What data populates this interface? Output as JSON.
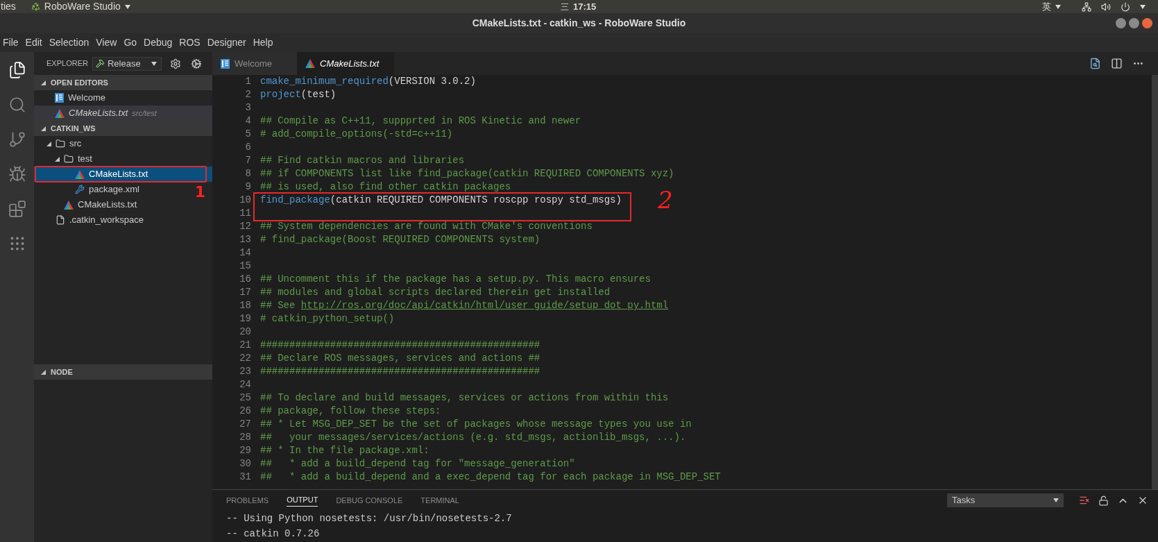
{
  "top_bar": {
    "activities": "ties",
    "app_menu": "RoboWare Studio",
    "menu_glyph": "三",
    "clock": "17:15",
    "input_method": "英"
  },
  "window": {
    "title": "CMakeLists.txt - catkin_ws - RoboWare Studio"
  },
  "menu": [
    "File",
    "Edit",
    "Selection",
    "View",
    "Go",
    "Debug",
    "ROS",
    "Designer",
    "Help"
  ],
  "activity_bar": [
    {
      "kind": "files",
      "selected": true
    },
    {
      "kind": "search",
      "selected": false
    },
    {
      "kind": "branch",
      "selected": false
    },
    {
      "kind": "debug",
      "selected": false
    },
    {
      "kind": "blocks",
      "selected": false
    },
    {
      "kind": "grid",
      "selected": false
    }
  ],
  "sidebar": {
    "title": "EXPLORER",
    "build_select": "Release",
    "open_editors": {
      "title": "OPEN EDITORS",
      "expanded": true,
      "items": [
        {
          "name": "Welcome",
          "kind": "welcome",
          "preview": false,
          "selected": false
        },
        {
          "name": "CMakeLists.txt",
          "kind": "cmake",
          "description": "src/test",
          "preview": true,
          "selected": true
        }
      ]
    },
    "workspace": {
      "title": "CATKIN_WS",
      "expanded": true,
      "items": [
        {
          "name": "src",
          "kind": "folder",
          "expanded": true,
          "selected": false,
          "boxed": false,
          "children": [
            {
              "name": "test",
              "kind": "folder",
              "expanded": true,
              "selected": false,
              "boxed": false,
              "children": [
                {
                  "name": "CMakeLists.txt",
                  "kind": "cmake",
                  "selected": true,
                  "boxed": true
                },
                {
                  "name": "package.xml",
                  "kind": "xml",
                  "selected": false,
                  "boxed": false,
                  "note": "1"
                }
              ]
            },
            {
              "name": "CMakeLists.txt",
              "kind": "cmake",
              "selected": false,
              "boxed": false
            }
          ]
        },
        {
          "name": ".catkin_workspace",
          "kind": "file",
          "selected": false,
          "boxed": false
        }
      ]
    },
    "node": {
      "title": "NODE",
      "expanded": true
    }
  },
  "tabs": [
    {
      "label": "Welcome",
      "kind": "welcome",
      "selected": false,
      "preview": false
    },
    {
      "label": "CMakeLists.txt",
      "kind": "cmake",
      "selected": true,
      "preview": true
    }
  ],
  "code": [
    {
      "number": "1",
      "boxed": false,
      "segments": [
        {
          "kind": "func",
          "text": "cmake_minimum_required"
        },
        {
          "kind": "text",
          "text": "(VERSION 3.0.2)"
        }
      ]
    },
    {
      "number": "2",
      "boxed": false,
      "segments": [
        {
          "kind": "func",
          "text": "project"
        },
        {
          "kind": "text",
          "text": "(test)"
        }
      ]
    },
    {
      "number": "3",
      "boxed": false
    },
    {
      "number": "4",
      "boxed": false,
      "segments": [
        {
          "kind": "comment",
          "text": "## Compile as C++11, suppprted in ROS Kinetic and newer"
        }
      ]
    },
    {
      "number": "5",
      "boxed": false,
      "segments": [
        {
          "kind": "comment",
          "text": "# add_compile_options(-std=c++11)"
        }
      ]
    },
    {
      "number": "6",
      "boxed": false
    },
    {
      "number": "7",
      "boxed": false,
      "segments": [
        {
          "kind": "comment",
          "text": "## Find catkin macros and libraries"
        }
      ]
    },
    {
      "number": "8",
      "boxed": false,
      "segments": [
        {
          "kind": "comment",
          "text": "## if COMPONENTS list like find_package(catkin REQUIRED COMPONENTS xyz)"
        }
      ]
    },
    {
      "number": "9",
      "boxed": false,
      "segments": [
        {
          "kind": "comment",
          "text": "## is used, also find other catkin packages"
        }
      ]
    },
    {
      "number": "10",
      "boxed": true,
      "note": "2",
      "segments": [
        {
          "kind": "func",
          "text": "find_package"
        },
        {
          "kind": "text",
          "text": "(catkin REQUIRED COMPONENTS roscpp rospy std_msgs)"
        }
      ]
    },
    {
      "number": "11",
      "boxed": true
    },
    {
      "number": "12",
      "boxed": false,
      "segments": [
        {
          "kind": "comment",
          "text": "## System dependencies are found with CMake's conventions"
        }
      ]
    },
    {
      "number": "13",
      "boxed": false,
      "segments": [
        {
          "kind": "comment",
          "text": "# find_package(Boost REQUIRED COMPONENTS system)"
        }
      ]
    },
    {
      "number": "14",
      "boxed": false
    },
    {
      "number": "15",
      "boxed": false
    },
    {
      "number": "16",
      "boxed": false,
      "segments": [
        {
          "kind": "comment",
          "text": "## Uncomment this if the package has a setup.py. This macro ensures"
        }
      ]
    },
    {
      "number": "17",
      "boxed": false,
      "segments": [
        {
          "kind": "comment",
          "text": "## modules and global scripts declared therein get installed"
        }
      ]
    },
    {
      "number": "18",
      "boxed": false,
      "segments": [
        {
          "kind": "comment",
          "text": "## See "
        },
        {
          "kind": "link",
          "text": "http://ros.org/doc/api/catkin/html/user_guide/setup_dot_py.html"
        }
      ]
    },
    {
      "number": "19",
      "boxed": false,
      "segments": [
        {
          "kind": "comment",
          "text": "# catkin_python_setup()"
        }
      ]
    },
    {
      "number": "20",
      "boxed": false
    },
    {
      "number": "21",
      "boxed": false,
      "segments": [
        {
          "kind": "comment",
          "text": "################################################"
        }
      ]
    },
    {
      "number": "22",
      "boxed": false,
      "segments": [
        {
          "kind": "comment",
          "text": "## Declare ROS messages, services and actions ##"
        }
      ]
    },
    {
      "number": "23",
      "boxed": false,
      "segments": [
        {
          "kind": "comment",
          "text": "################################################"
        }
      ]
    },
    {
      "number": "24",
      "boxed": false
    },
    {
      "number": "25",
      "boxed": false,
      "segments": [
        {
          "kind": "comment",
          "text": "## To declare and build messages, services or actions from within this"
        }
      ]
    },
    {
      "number": "26",
      "boxed": false,
      "segments": [
        {
          "kind": "comment",
          "text": "## package, follow these steps:"
        }
      ]
    },
    {
      "number": "27",
      "boxed": false,
      "segments": [
        {
          "kind": "comment",
          "text": "## * Let MSG_DEP_SET be the set of packages whose message types you use in"
        }
      ]
    },
    {
      "number": "28",
      "boxed": false,
      "segments": [
        {
          "kind": "comment",
          "text": "##   your messages/services/actions (e.g. std_msgs, actionlib_msgs, ...)."
        }
      ]
    },
    {
      "number": "29",
      "boxed": false,
      "segments": [
        {
          "kind": "comment",
          "text": "## * In the file package.xml:"
        }
      ]
    },
    {
      "number": "30",
      "boxed": false,
      "segments": [
        {
          "kind": "comment",
          "text": "##   * add a build_depend tag for \"message_generation\""
        }
      ]
    },
    {
      "number": "31",
      "boxed": false,
      "segments": [
        {
          "kind": "comment",
          "text": "##   * add a build_depend and a exec_depend tag for each package in MSG_DEP_SET"
        }
      ]
    }
  ],
  "panel": {
    "tabs": [
      {
        "label": "PROBLEMS",
        "selected": false
      },
      {
        "label": "OUTPUT",
        "selected": true
      },
      {
        "label": "DEBUG CONSOLE",
        "selected": false
      },
      {
        "label": "TERMINAL",
        "selected": false
      }
    ],
    "channel_select": "Tasks",
    "output": [
      "-- Using Python nosetests: /usr/bin/nosetests-2.7",
      "-- catkin 0.7.26"
    ]
  }
}
